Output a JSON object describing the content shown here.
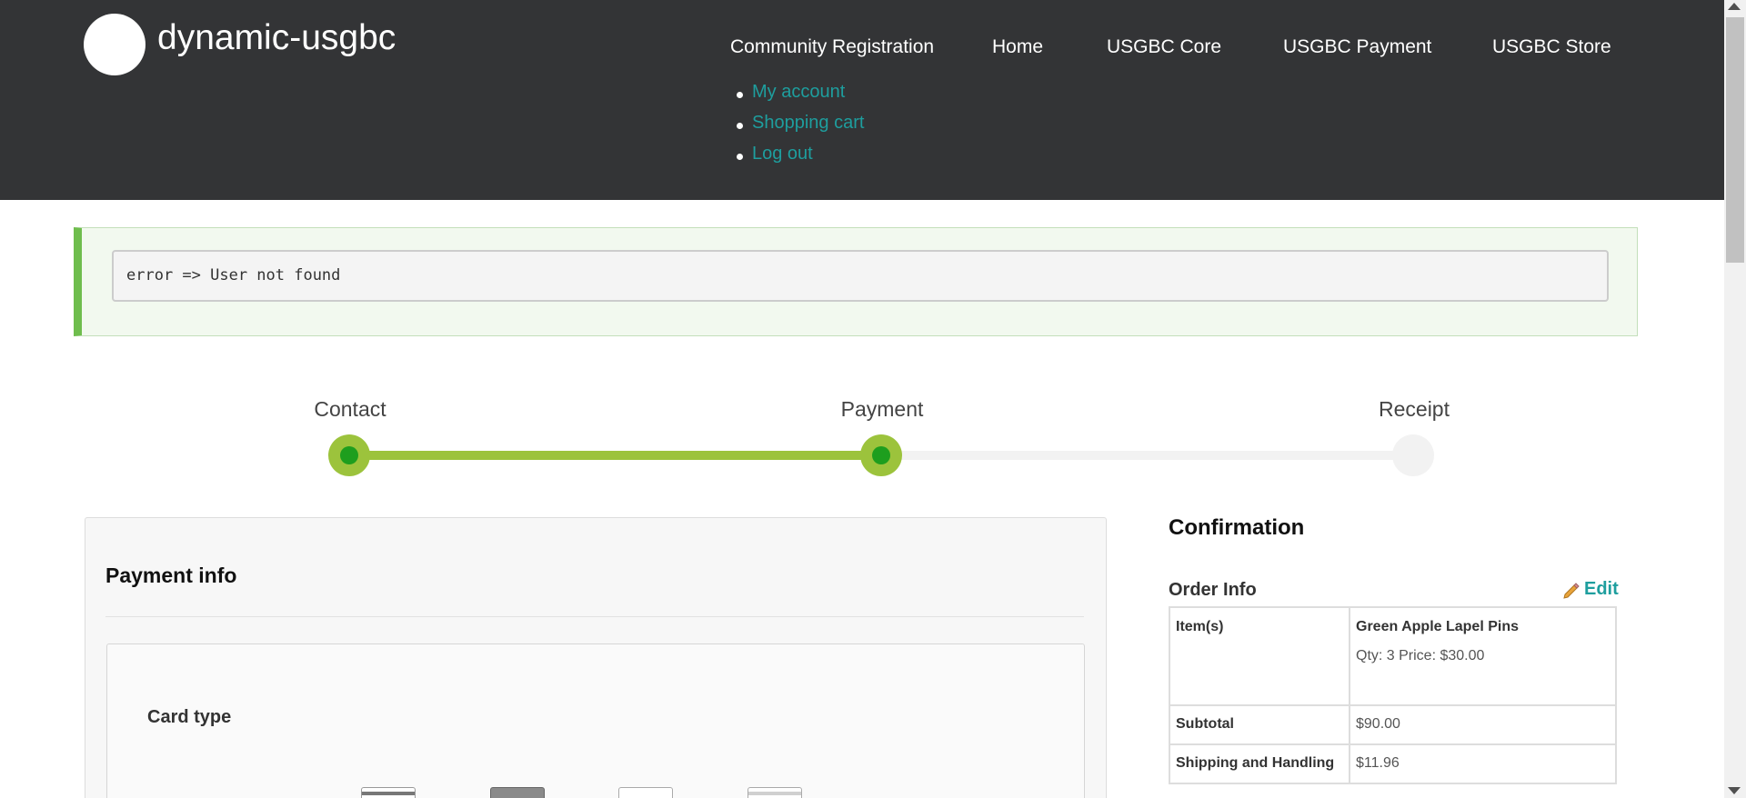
{
  "header": {
    "site_name": "dynamic-usgbc",
    "nav": [
      {
        "label": "Community Registration"
      },
      {
        "label": "Home"
      },
      {
        "label": "USGBC Core"
      },
      {
        "label": "USGBC Payment"
      },
      {
        "label": "USGBC Store"
      }
    ],
    "user_menu": [
      {
        "label": "My account"
      },
      {
        "label": "Shopping cart"
      },
      {
        "label": "Log out"
      }
    ],
    "background_color": "#333436"
  },
  "message": {
    "text": "error => User not found",
    "accent_color": "#6fbd4d"
  },
  "progress": {
    "steps": [
      {
        "label": "Contact",
        "status": "complete"
      },
      {
        "label": "Payment",
        "status": "current"
      },
      {
        "label": "Receipt",
        "status": "pending"
      }
    ],
    "active_color": "#9cc33c"
  },
  "payment": {
    "title": "Payment info",
    "card_type_label": "Card type",
    "card_icons": [
      "visa-card-icon",
      "mastercard-card-icon",
      "amex-card-icon",
      "discover-card-icon"
    ]
  },
  "confirmation": {
    "title": "Confirmation",
    "order_info_label": "Order Info",
    "edit_label": "Edit",
    "rows": {
      "items_label": "Item(s)",
      "item_name": "Green Apple Lapel Pins",
      "item_meta": "Qty: 3 Price: $30.00",
      "subtotal_label": "Subtotal",
      "subtotal_value": "$90.00",
      "shipping_label": "Shipping and Handling",
      "shipping_value": "$11.96"
    }
  }
}
